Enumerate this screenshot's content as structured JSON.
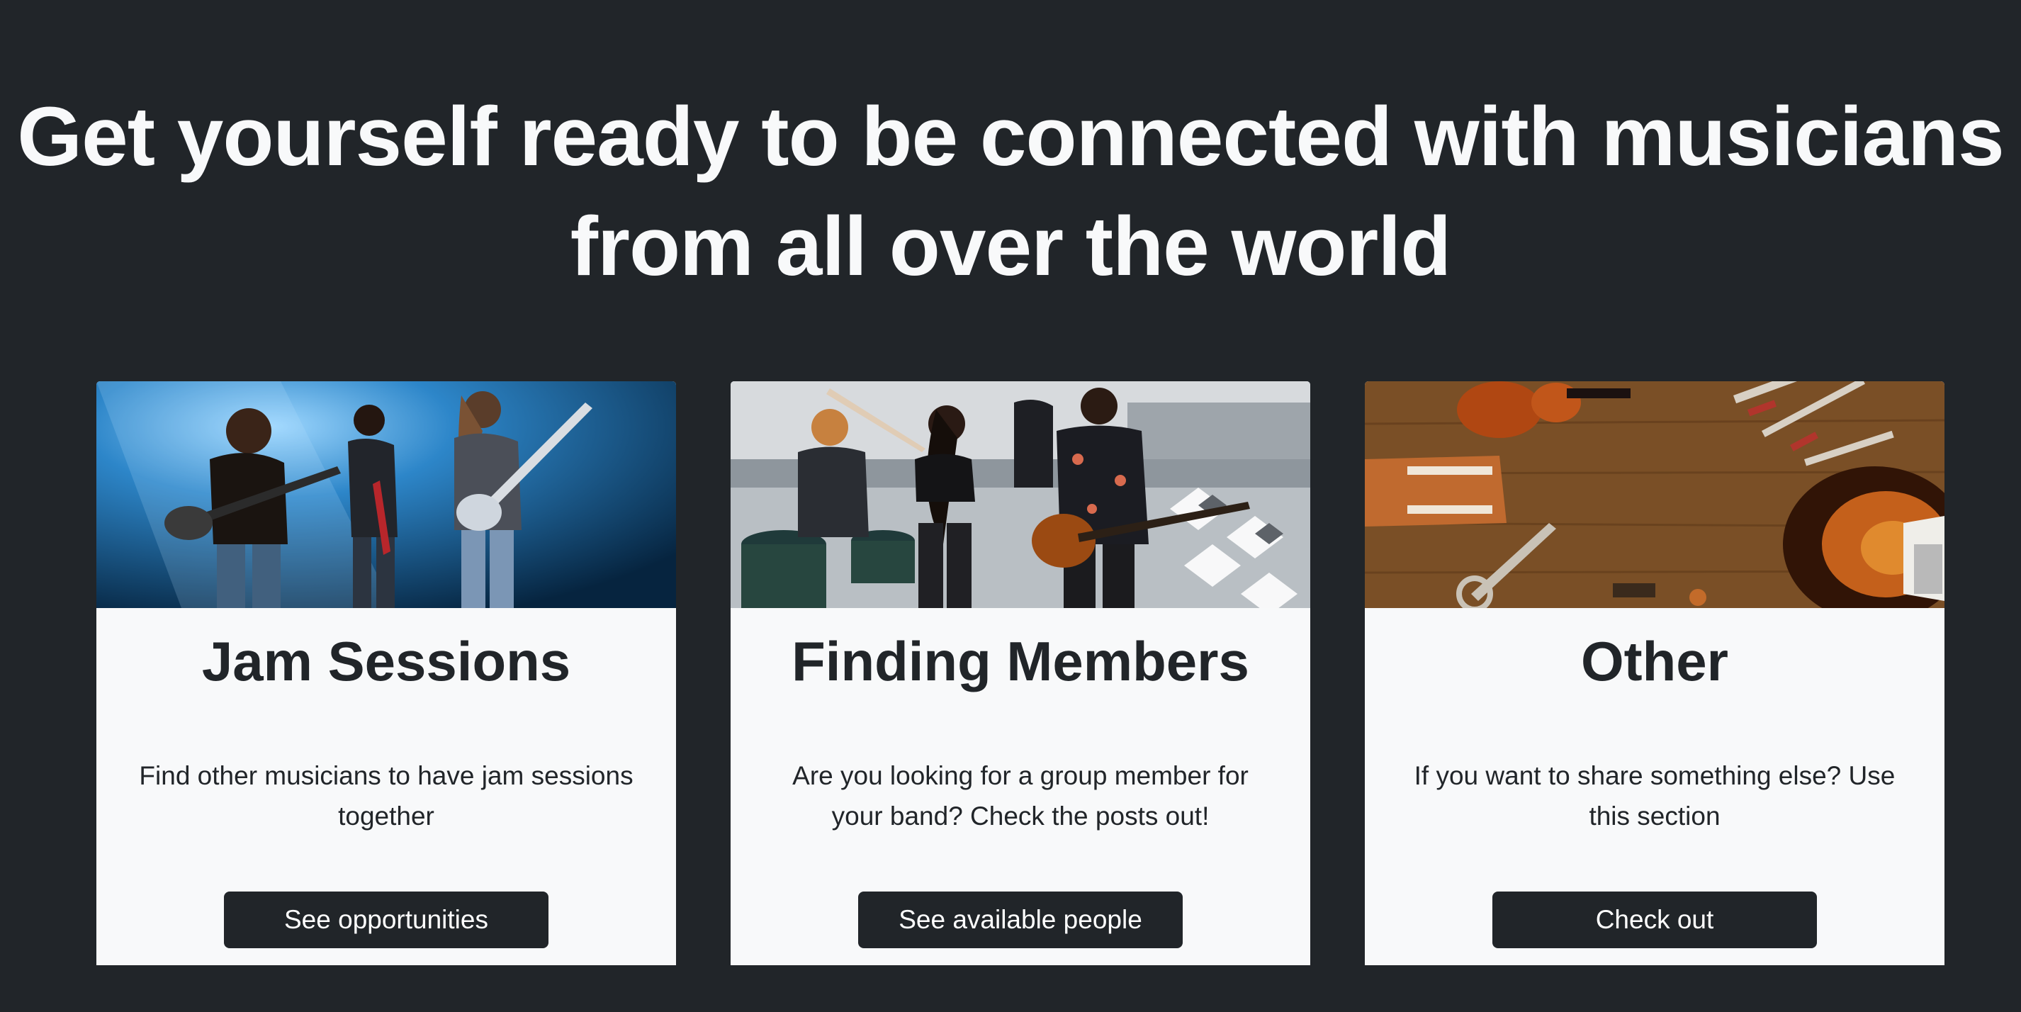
{
  "hero": {
    "title": "Get yourself ready to be connected with musicians from all over the world"
  },
  "cards": [
    {
      "image": "band-on-stage-photo",
      "title": "Jam Sessions",
      "text": "Find other musicians to have jam sessions together",
      "button_label": "See opportunities"
    },
    {
      "image": "rooftop-band-photo",
      "title": "Finding Members",
      "text": "Are you looking for a group member for your band? Check the posts out!",
      "button_label": "See available people"
    },
    {
      "image": "instruments-on-wood-photo",
      "title": "Other",
      "text": "If you want to share something else? Use this section",
      "button_label": "Check out"
    }
  ],
  "colors": {
    "page_background": "#212529",
    "card_background": "#f8f9fa",
    "button_background": "#212529",
    "heading_text": "#f8f9fa"
  }
}
